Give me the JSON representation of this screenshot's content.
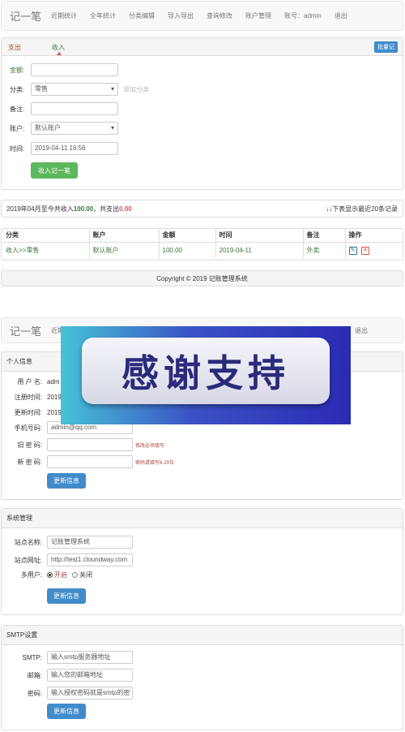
{
  "nav_top": {
    "brand": "记一笔",
    "items": [
      "近期统计",
      "全年统计",
      "分类编辑",
      "导入导出",
      "查询修改",
      "账户管理",
      "账号：admin",
      "退出"
    ]
  },
  "record_panel": {
    "tabs": [
      "支出",
      "收入"
    ],
    "batch_button": "批量记",
    "amount_label": "金额:",
    "amount_value": "",
    "category_label": "分类:",
    "category_value": "零售",
    "add_category_link": "添加分类",
    "note_label": "备注:",
    "note_value": "",
    "account_label": "账户:",
    "account_value": "默认账户",
    "time_label": "时间:",
    "time_value": "2019-04-11 16:56",
    "submit_label": "收入记一笔"
  },
  "summary": {
    "prefix": "2019年04月至今共收入",
    "income": "100.00",
    "middle": "，共支出",
    "expense": "0.00",
    "right_text": "↓↓下表显示最近20条记录"
  },
  "table": {
    "headers": [
      "分类",
      "账户",
      "金额",
      "时间",
      "备注",
      "操作"
    ],
    "rows": [
      [
        "收入>>零售",
        "默认账户",
        "100.00",
        "2019-04-11",
        "外卖"
      ]
    ]
  },
  "footer": "Copyright © 2019 记账管理系统",
  "nav_bottom": {
    "brand": "记一笔",
    "first_item": "近期",
    "last_item": "退出"
  },
  "banner": {
    "text": "感谢支持",
    "colors": {
      "left": "#46c3d6",
      "right": "#2a2bb4",
      "text": "#2b2a7a"
    }
  },
  "personal_panel": {
    "title": "个人信息",
    "username_label": "用 户 名:",
    "username_value": "adm",
    "register_label": "注册时间:",
    "register_value": "2019",
    "update_label": "更新时间:",
    "update_value": "2019",
    "phone_label": "手机号码:",
    "phone_value": "admin@qq.com",
    "old_pwd_label": "旧 密 码:",
    "old_pwd_hint": "修改必须填写",
    "new_pwd_label": "新 密 码:",
    "new_pwd_hint": "密码请填写6-20位",
    "submit_label": "更新信息"
  },
  "system_panel": {
    "title": "系统管理",
    "site_name_label": "站点名称:",
    "site_name_value": "记账管理系统",
    "site_url_label": "站点网址:",
    "site_url_value": "http://test1.cloundway.com",
    "multi_user_label": "多用户:",
    "option_on": "开启",
    "option_off": "关闭",
    "submit_label": "更新信息"
  },
  "smtp_panel": {
    "title": "SMTP设置",
    "smtp_label": "SMTP:",
    "smtp_placeholder": "输入smtp服务器地址",
    "email_label": "邮箱:",
    "email_placeholder": "输入您的邮箱地址",
    "password_label": "密码:",
    "password_placeholder": "输入授权密码就是smtp的密",
    "submit_label": "更新信息"
  }
}
